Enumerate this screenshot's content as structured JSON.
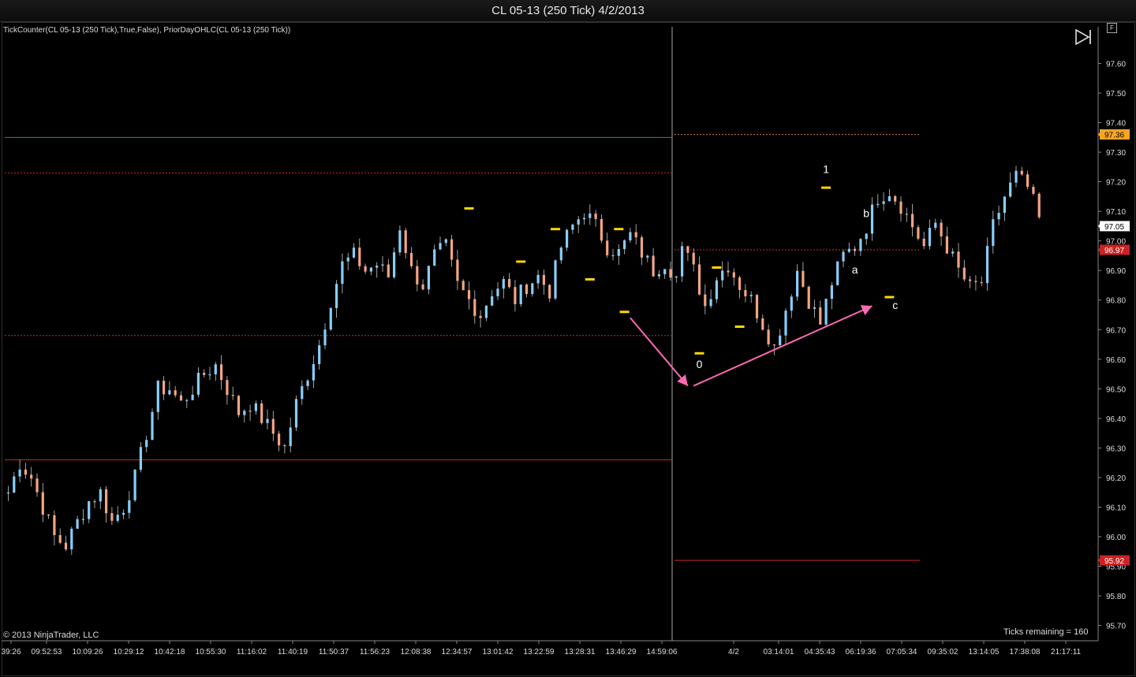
{
  "window": {
    "title": "CL 05-13 (250 Tick)  4/2/2013"
  },
  "indicator_label": "TickCounter(CL 05-13 (250 Tick),True,False), PriorDayOHLC(CL 05-13 (250 Tick))",
  "copyright": "© 2013 NinjaTrader, LLC",
  "ticks_remaining": "Ticks remaining = 160",
  "f_button_label": "F",
  "icons": {
    "jump_to_end": "skip-to-end-icon"
  },
  "colors": {
    "background": "#000000",
    "up_bar": "#87cefa",
    "down_bar": "#f4a582",
    "wick": "#c8c8c8",
    "swing_marker": "#ffd700",
    "arrow": "#ff69b4",
    "prior_high": "#2e8b57",
    "prior_low_open": "#d62728",
    "prior_close": "#d62728",
    "session_divider": "#d0d0d0"
  },
  "chart_data": {
    "type": "candlestick",
    "instrument": "CL 05-13",
    "interval": "250 Tick",
    "ylim": [
      95.65,
      97.75
    ],
    "y_ticks": [
      95.7,
      95.8,
      95.9,
      96.0,
      96.1,
      96.2,
      96.3,
      96.4,
      96.5,
      96.6,
      96.7,
      96.8,
      96.9,
      97.0,
      97.1,
      97.2,
      97.3,
      97.4,
      97.5,
      97.6
    ],
    "x_tick_labels": [
      "39:26",
      "09:52:53",
      "10:09:26",
      "10:29:12",
      "10:42:18",
      "10:55:30",
      "11:16:02",
      "11:40:19",
      "11:50:37",
      "11:56:23",
      "12:08:38",
      "12:34:57",
      "13:01:42",
      "13:22:59",
      "13:28:31",
      "13:46:29",
      "14:59:06",
      "4/2",
      "03:14:01",
      "04:35:43",
      "06:19:36",
      "07:05:34",
      "09:35:02",
      "13:14:05",
      "17:38:08",
      "21:17:11"
    ],
    "price_path_day1": [
      96.15,
      96.25,
      96.2,
      96.1,
      96.0,
      95.97,
      96.05,
      96.12,
      96.15,
      96.05,
      96.1,
      96.2,
      96.35,
      96.5,
      96.5,
      96.45,
      96.5,
      96.55,
      96.58,
      96.5,
      96.42,
      96.45,
      96.4,
      96.35,
      96.3,
      96.45,
      96.55,
      96.65,
      96.8,
      96.92,
      96.95,
      96.9,
      96.92,
      96.88,
      97.05,
      96.9,
      96.85,
      96.95,
      96.98,
      96.85,
      96.8,
      96.75,
      96.83,
      96.86,
      96.8,
      96.85,
      96.88,
      96.83,
      96.98,
      97.05,
      97.1,
      97.05,
      96.98,
      96.96,
      97.02,
      96.96,
      96.9,
      96.93,
      96.88
    ],
    "price_path_day2": [
      96.98,
      96.9,
      96.78,
      96.88,
      96.92,
      96.85,
      96.8,
      96.72,
      96.64,
      96.77,
      96.9,
      96.8,
      96.72,
      96.86,
      96.95,
      96.98,
      97.05,
      97.15,
      97.17,
      97.12,
      97.05,
      96.98,
      97.06,
      96.98,
      96.9,
      96.84,
      96.86,
      97.05,
      97.15,
      97.22,
      97.18,
      97.08
    ],
    "reference_lines": [
      {
        "name": "prior_day_high",
        "value": 97.35,
        "color": "#2e8b57",
        "style": "solid",
        "session": 1
      },
      {
        "name": "line_97_23",
        "value": 97.23,
        "color": "#d62728",
        "style": "dashed",
        "session": 1
      },
      {
        "name": "line_96_68",
        "value": 96.68,
        "color": "#d62728",
        "style": "dashed",
        "session": 1
      },
      {
        "name": "line_96_26",
        "value": 96.26,
        "color": "#d62728",
        "style": "solid",
        "session": 1
      },
      {
        "name": "line_97_36",
        "value": 97.36,
        "color": "#d08040",
        "style": "dashed",
        "session": 2
      },
      {
        "name": "prior_close",
        "value": 96.97,
        "color": "#d62728",
        "style": "dashed",
        "session": 2
      },
      {
        "name": "prior_low",
        "value": 95.92,
        "color": "#d62728",
        "style": "solid",
        "session": 2
      }
    ],
    "price_badges": [
      {
        "value": 97.36,
        "label": "97.36",
        "bg": "#f5a623",
        "fg": "#000000"
      },
      {
        "value": 97.05,
        "label": "97.05",
        "bg": "#ffffff",
        "fg": "#000000"
      },
      {
        "value": 96.97,
        "label": "96.97",
        "bg": "#cc2222",
        "fg": "#ffffff"
      },
      {
        "value": 95.92,
        "label": "95.92",
        "bg": "#cc2222",
        "fg": "#ffffff"
      }
    ],
    "swing_markers": [
      {
        "bar": 80,
        "value": 97.11
      },
      {
        "bar": 89,
        "value": 96.93
      },
      {
        "bar": 95,
        "value": 97.04
      },
      {
        "bar": 101,
        "value": 96.87
      },
      {
        "bar": 106,
        "value": 97.04
      },
      {
        "bar": 107,
        "value": 96.76
      },
      {
        "bar": 120,
        "value": 96.62
      },
      {
        "bar": 123,
        "value": 96.91
      },
      {
        "bar": 127,
        "value": 96.71
      },
      {
        "bar": 142,
        "value": 97.18
      },
      {
        "bar": 153,
        "value": 96.81
      }
    ],
    "wave_labels": [
      {
        "text": "0",
        "bar": 120,
        "value": 96.57
      },
      {
        "text": "1",
        "bar": 142,
        "value": 97.23
      },
      {
        "text": "a",
        "bar": 147,
        "value": 96.89
      },
      {
        "text": "b",
        "bar": 149,
        "value": 97.08
      },
      {
        "text": "c",
        "bar": 154,
        "value": 96.77
      }
    ],
    "arrows": [
      {
        "from_bar": 108,
        "from_value": 96.74,
        "to_bar": 118,
        "to_value": 96.51
      },
      {
        "from_bar": 119,
        "from_value": 96.51,
        "to_bar": 150,
        "to_value": 96.78
      }
    ]
  }
}
